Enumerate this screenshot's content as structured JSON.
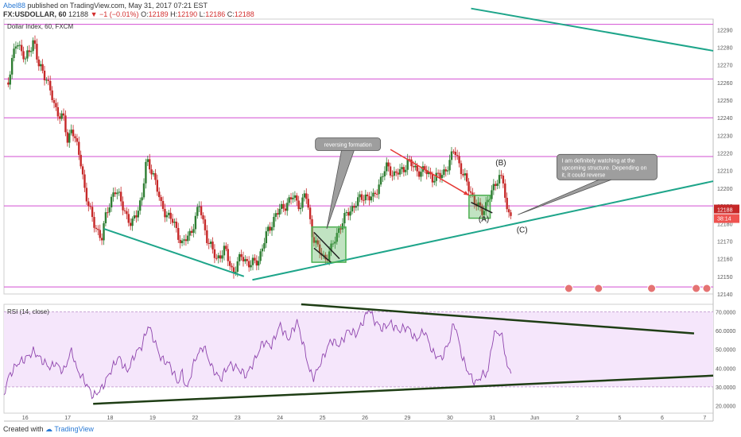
{
  "header": {
    "author": "Abel88",
    "published": "published on TradingView.com, May 31, 2017 07:21 EST",
    "symbol": "FX:USDOLLAR, 60",
    "last": "12188",
    "change": "−1 (−0.01%)",
    "o_label": "O:",
    "o_value": "12189",
    "h_label": "H:",
    "h_value": "12190",
    "l_label": "L:",
    "l_value": "12186",
    "c_label": "C:",
    "c_value": "12188"
  },
  "chart_title": "Dollar Index, 60, FXCM",
  "rsi_title": "RSI (14, close)",
  "footer": {
    "created_with": "Created with",
    "brand": "TradingView"
  },
  "colors": {
    "up": "#2e7d32",
    "down": "#c62828",
    "hline": "#d24fd2",
    "trend": "#1ea58a",
    "rsi_line": "#8e44ad",
    "rsi_band": "#f5e6fb",
    "rsi_trend": "#1e3d14",
    "box": "#4caf50",
    "arrow": "#e53935",
    "callout": "#9e9e9e"
  },
  "chart_data": [
    {
      "type": "candlestick",
      "title": "Dollar Index, 60, FXCM",
      "ylim": [
        12140,
        12296
      ],
      "yticks": [
        12290,
        12280,
        12270,
        12260,
        12250,
        12240,
        12230,
        12220,
        12210,
        12200,
        12190,
        12180,
        12170,
        12160,
        12150,
        12140
      ],
      "x_ticks": [
        "16",
        "17",
        "18",
        "19",
        "22",
        "23",
        "24",
        "25",
        "26",
        "29",
        "30",
        "31",
        "Jun",
        "2",
        "5",
        "6",
        "7"
      ],
      "x_tick_days": [
        0,
        1,
        2,
        3,
        4,
        5,
        6,
        7,
        8,
        9,
        10,
        11,
        12,
        13,
        14,
        15,
        16
      ],
      "day_range": [
        -0.5,
        16.2
      ],
      "current_price": "12188",
      "countdown": "38:14",
      "horizontal_levels": [
        12293,
        12262,
        12240,
        12218,
        12190,
        12144
      ],
      "close_path": [
        [
          -0.4,
          12260
        ],
        [
          -0.2,
          12285
        ],
        [
          0.0,
          12272
        ],
        [
          0.2,
          12285
        ],
        [
          0.3,
          12270
        ],
        [
          0.5,
          12263
        ],
        [
          0.7,
          12245
        ],
        [
          0.9,
          12240
        ],
        [
          1.0,
          12225
        ],
        [
          1.1,
          12236
        ],
        [
          1.3,
          12215
        ],
        [
          1.4,
          12200
        ],
        [
          1.6,
          12180
        ],
        [
          1.8,
          12172
        ],
        [
          1.9,
          12184
        ],
        [
          2.1,
          12200
        ],
        [
          2.3,
          12190
        ],
        [
          2.5,
          12178
        ],
        [
          2.6,
          12185
        ],
        [
          2.75,
          12195
        ],
        [
          2.85,
          12215
        ],
        [
          3.0,
          12210
        ],
        [
          3.2,
          12190
        ],
        [
          3.5,
          12180
        ],
        [
          3.7,
          12168
        ],
        [
          3.9,
          12175
        ],
        [
          4.1,
          12190
        ],
        [
          4.3,
          12170
        ],
        [
          4.5,
          12160
        ],
        [
          4.7,
          12165
        ],
        [
          4.9,
          12152
        ],
        [
          5.1,
          12162
        ],
        [
          5.3,
          12156
        ],
        [
          5.5,
          12160
        ],
        [
          5.7,
          12175
        ],
        [
          5.9,
          12185
        ],
        [
          6.1,
          12190
        ],
        [
          6.3,
          12195
        ],
        [
          6.5,
          12190
        ],
        [
          6.6,
          12198
        ],
        [
          6.75,
          12175
        ],
        [
          6.9,
          12165
        ],
        [
          7.05,
          12160
        ],
        [
          7.2,
          12165
        ],
        [
          7.4,
          12178
        ],
        [
          7.6,
          12186
        ],
        [
          7.8,
          12192
        ],
        [
          8.0,
          12196
        ],
        [
          8.2,
          12194
        ],
        [
          8.35,
          12204
        ],
        [
          8.5,
          12212
        ],
        [
          8.7,
          12208
        ],
        [
          8.9,
          12210
        ],
        [
          9.0,
          12216
        ],
        [
          9.2,
          12210
        ],
        [
          9.4,
          12210
        ],
        [
          9.6,
          12206
        ],
        [
          9.8,
          12207
        ],
        [
          10.0,
          12215
        ],
        [
          10.1,
          12222
        ],
        [
          10.2,
          12216
        ],
        [
          10.3,
          12208
        ],
        [
          10.45,
          12200
        ],
        [
          10.6,
          12192
        ],
        [
          10.75,
          12186
        ],
        [
          10.9,
          12194
        ],
        [
          11.05,
          12200
        ],
        [
          11.15,
          12208
        ],
        [
          11.25,
          12205
        ],
        [
          11.35,
          12184
        ],
        [
          11.45,
          12188
        ]
      ],
      "trendlines": [
        {
          "from": [
            1.85,
            12177
          ],
          "to": [
            5.15,
            12150
          ]
        },
        {
          "from": [
            5.35,
            12148
          ],
          "to": [
            16.2,
            12204
          ]
        },
        {
          "from": [
            10.5,
            12302
          ],
          "to": [
            16.2,
            12278
          ]
        }
      ],
      "highlight_boxes": [
        {
          "from": [
            6.75,
            12178
          ],
          "to": [
            7.55,
            12158
          ]
        },
        {
          "from": [
            10.45,
            12196
          ],
          "to": [
            10.95,
            12183
          ]
        }
      ],
      "red_arrow": {
        "from": [
          8.6,
          12222
        ],
        "to": [
          10.45,
          12196
        ]
      },
      "annotations": [
        {
          "text": "reversing formation",
          "at": [
            7.6,
            12225
          ],
          "tip": [
            7.1,
            12177
          ]
        },
        {
          "text": "I am definitely watching at the upcoming structure. Depending on it, it could reverse",
          "at": [
            13.7,
            12212
          ],
          "tip": [
            11.6,
            12185
          ]
        }
      ],
      "wave_labels": [
        {
          "text": "(A)",
          "at": [
            10.8,
            12181
          ]
        },
        {
          "text": "(B)",
          "at": [
            11.2,
            12213
          ]
        },
        {
          "text": "(C)",
          "at": [
            11.7,
            12175
          ]
        }
      ]
    },
    {
      "type": "line",
      "title": "RSI (14, close)",
      "ylim": [
        16,
        74
      ],
      "yticks": [
        70,
        60,
        50,
        40,
        30,
        20
      ],
      "yticks_labels": [
        "70.0000",
        "60.0000",
        "50.0000",
        "40.0000",
        "30.0000",
        "20.0000"
      ],
      "band": [
        30,
        70
      ],
      "current_value": "39",
      "series_path": [
        [
          -0.5,
          26
        ],
        [
          -0.4,
          35
        ],
        [
          -0.2,
          42
        ],
        [
          0.0,
          45
        ],
        [
          0.2,
          49
        ],
        [
          0.4,
          44
        ],
        [
          0.6,
          40
        ],
        [
          0.7,
          43
        ],
        [
          0.9,
          38
        ],
        [
          1.1,
          50
        ],
        [
          1.2,
          40
        ],
        [
          1.4,
          33
        ],
        [
          1.6,
          25
        ],
        [
          1.8,
          29
        ],
        [
          2.0,
          38
        ],
        [
          2.2,
          46
        ],
        [
          2.4,
          38
        ],
        [
          2.6,
          48
        ],
        [
          2.75,
          52
        ],
        [
          2.9,
          63
        ],
        [
          3.0,
          57
        ],
        [
          3.2,
          45
        ],
        [
          3.4,
          42
        ],
        [
          3.6,
          32
        ],
        [
          3.7,
          38
        ],
        [
          3.8,
          28
        ],
        [
          4.0,
          45
        ],
        [
          4.2,
          52
        ],
        [
          4.4,
          40
        ],
        [
          4.6,
          34
        ],
        [
          4.8,
          42
        ],
        [
          5.0,
          40
        ],
        [
          5.2,
          36
        ],
        [
          5.4,
          44
        ],
        [
          5.6,
          54
        ],
        [
          5.8,
          52
        ],
        [
          6.0,
          63
        ],
        [
          6.2,
          55
        ],
        [
          6.4,
          65
        ],
        [
          6.6,
          48
        ],
        [
          6.7,
          38
        ],
        [
          6.8,
          35
        ],
        [
          7.0,
          45
        ],
        [
          7.2,
          55
        ],
        [
          7.4,
          52
        ],
        [
          7.6,
          60
        ],
        [
          7.8,
          58
        ],
        [
          8.0,
          67
        ],
        [
          8.1,
          72
        ],
        [
          8.2,
          66
        ],
        [
          8.4,
          61
        ],
        [
          8.6,
          64
        ],
        [
          8.8,
          60
        ],
        [
          9.0,
          62
        ],
        [
          9.2,
          55
        ],
        [
          9.4,
          60
        ],
        [
          9.6,
          48
        ],
        [
          9.8,
          45
        ],
        [
          10.0,
          55
        ],
        [
          10.1,
          65
        ],
        [
          10.2,
          55
        ],
        [
          10.3,
          45
        ],
        [
          10.45,
          37
        ],
        [
          10.6,
          32
        ],
        [
          10.75,
          36
        ],
        [
          10.9,
          38
        ],
        [
          11.0,
          55
        ],
        [
          11.1,
          60
        ],
        [
          11.25,
          56
        ],
        [
          11.35,
          40
        ],
        [
          11.45,
          39
        ]
      ],
      "trendlines": [
        {
          "from": [
            6.5,
            74
          ],
          "to": [
            15.75,
            58.5
          ]
        },
        {
          "from": [
            1.6,
            21
          ],
          "to": [
            16.2,
            36
          ]
        }
      ]
    }
  ]
}
